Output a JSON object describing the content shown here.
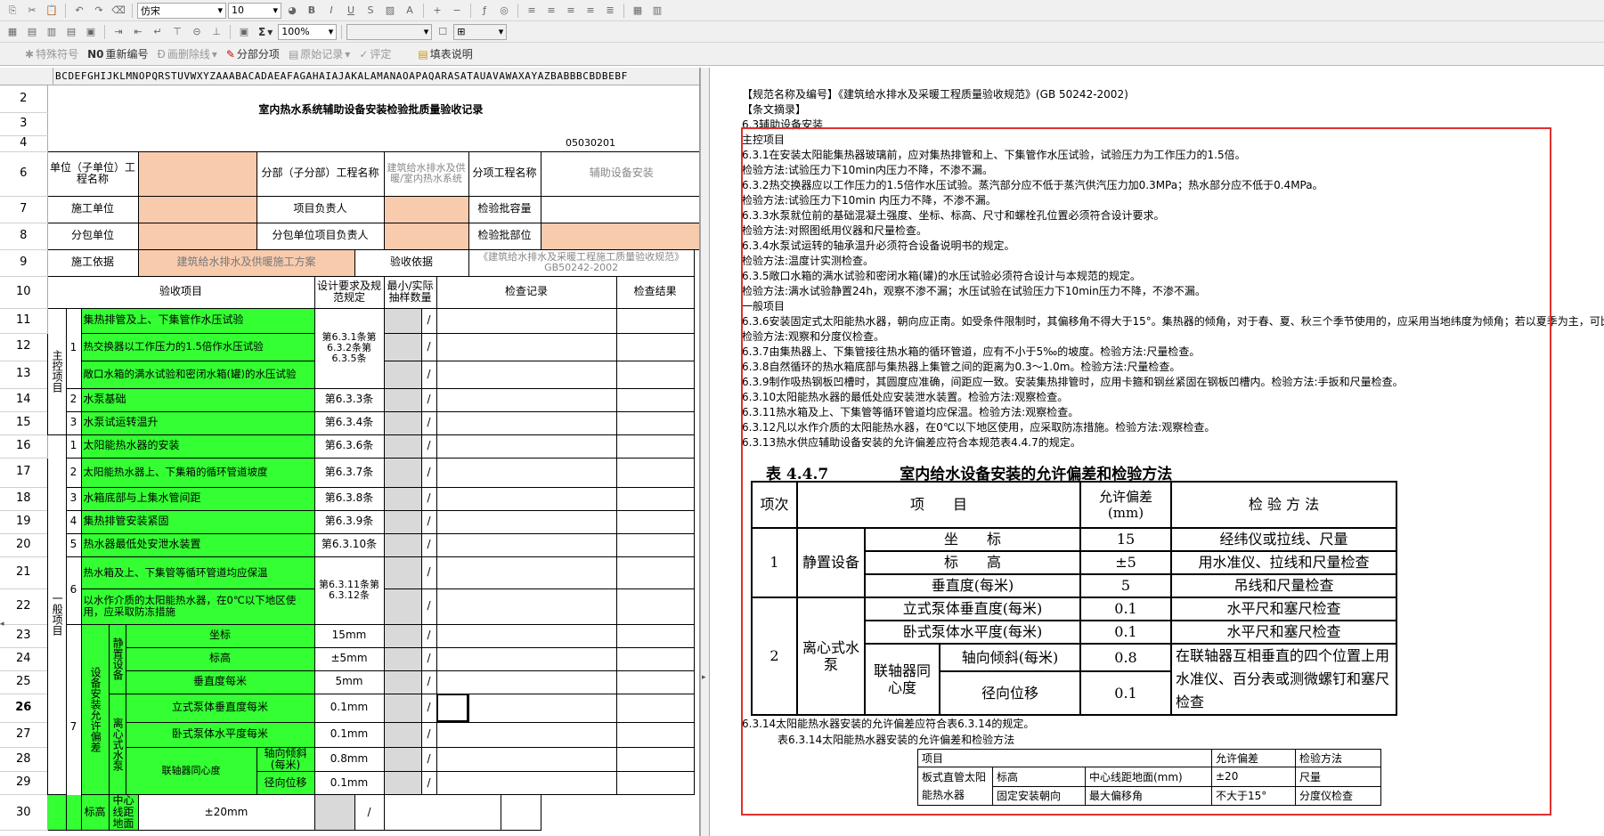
{
  "toolbar": {
    "font_family": "仿宋",
    "font_size": "10",
    "zoom": "100%",
    "special_symbol": "特殊符号",
    "renumber": "重新编号",
    "delete_line": "画删除线",
    "sub_item": "分部分项",
    "origin_record": "原始记录",
    "evaluate": "评定",
    "form_desc": "填表说明",
    "sigma": "Σ"
  },
  "sheet": {
    "col_letters": "BCDEFGHIJKLMNOPQRSTUVWXYZAAABACADAEAFAGAHAIAJAKALAMANAOAPAQARASATAUAVAWAXAYAZBABBBCBDBEBF",
    "rows": [
      "2",
      "3",
      "4",
      "6",
      "7",
      "8",
      "9",
      "10",
      "11",
      "12",
      "13",
      "14",
      "15",
      "16",
      "17",
      "18",
      "19",
      "20",
      "21",
      "22",
      "23",
      "24",
      "25",
      "26",
      "27",
      "28",
      "29",
      "30"
    ],
    "title": "室内热水系统辅助设备安装检验批质量验收记录",
    "code": "05030201",
    "unit_label": "单位（子单位）工程名称",
    "division_label": "分部（子分部）工程名称",
    "division_value": "建筑给水排水及供暖/室内热水系统",
    "subitem_label": "分项工程名称",
    "subitem_value": "辅助设备安装",
    "builder_label": "施工单位",
    "pm_label": "项目负责人",
    "capacity_label": "检验批容量",
    "subcontract_label": "分包单位",
    "subpm_label": "分包单位项目负责人",
    "location_label": "检验批部位",
    "basis_label": "施工依据",
    "basis_value": "建筑给水排水及供暖施工方案",
    "accept_basis_label": "验收依据",
    "accept_basis_value": "《建筑给水排水及采暖工程施工质量验收规范》GB50242-2002",
    "h_item": "验收项目",
    "h_design": "设计要求及规范规定",
    "h_sample": "最小/实际抽样数量",
    "h_record": "检查记录",
    "h_result": "检查结果",
    "main_group": "主控项目",
    "general_group": "一般项目",
    "slash": "/",
    "m1": "1",
    "m1a": "集热排管及上、下集管作水压试验",
    "m1b": "热交换器以工作压力的1.5倍作水压试验",
    "m1c": "敞口水箱的满水试验和密闭水箱(罐)的水压试验",
    "m1_spec": "第6.3.1条第6.3.2条第6.3.5条",
    "m2": "2",
    "m2a": "水泵基础",
    "m2_spec": "第6.3.3条",
    "m3": "3",
    "m3a": "水泵试运转温升",
    "m3_spec": "第6.3.4条",
    "g1": "1",
    "g1a": "太阳能热水器的安装",
    "g1_spec": "第6.3.6条",
    "g2": "2",
    "g2a": "太阳能热水器上、下集箱的循环管道坡度",
    "g2_spec": "第6.3.7条",
    "g3": "3",
    "g3a": "水箱底部与上集水管间距",
    "g3_spec": "第6.3.8条",
    "g4": "4",
    "g4a": "集热排管安装紧固",
    "g4_spec": "第6.3.9条",
    "g5": "5",
    "g5a": "热水器最低处安泄水装置",
    "g5_spec": "第6.3.10条",
    "g6": "6",
    "g6a": "热水箱及上、下集管等循环管道均应保温",
    "g6b": "以水作介质的太阳能热水器，在0℃以下地区使用，应采取防冻措施",
    "g6_spec": "第6.3.11条第6.3.12条",
    "g7": "7",
    "g7_group": "设备安装允许偏差",
    "static_equip": "静置设备",
    "coord": "坐标",
    "coord_spec": "15mm",
    "elev": "标高",
    "elev_spec": "±5mm",
    "vert": "垂直度每米",
    "vert_spec": "5mm",
    "centrifugal": "离心式水泵",
    "pump_vert": "立式泵体垂直度每米",
    "pump_vert_spec": "0.1mm",
    "pump_horiz": "卧式泵体水平度每米",
    "pump_horiz_spec": "0.1mm",
    "coupling": "联轴器同心度",
    "axial": "轴向倾斜(每米)",
    "axial_spec": "0.8mm",
    "radial": "径向位移",
    "radial_spec": "0.1mm",
    "r30a": "标高",
    "r30b": "中心线距地面",
    "r30_spec": "±20mm"
  },
  "doc": {
    "lines": [
      "【规范名称及编号】《建筑给水排水及采暖工程质量验收规范》(GB 50242-2002)",
      "【条文摘录】",
      "6.3辅助设备安装",
      "主控项目",
      "6.3.1在安装太阳能集热器玻璃前，应对集热排管和上、下集管作水压试验，试验压力为工作压力的1.5倍。",
      "检验方法:试验压力下10min内压力不降，不渗不漏。",
      "6.3.2热交换器应以工作压力的1.5倍作水压试验。蒸汽部分应不低于蒸汽供汽压力加0.3MPa；热水部分应不低于0.4MPa。",
      "检验方法:试验压力下10min 内压力不降，不渗不漏。",
      "6.3.3水泵就位前的基础混凝土强度、坐标、标高、尺寸和螺栓孔位置必须符合设计要求。",
      "检验方法:对照图纸用仪器和尺量检查。",
      "6.3.4水泵试运转的轴承温升必须符合设备说明书的规定。",
      "检验方法:温度计实测检查。",
      "6.3.5敞口水箱的满水试验和密闭水箱(罐)的水压试验必须符合设计与本规范的规定。",
      "检验方法:满水试验静置24h，观察不渗不漏；水压试验在试验压力下10min压力不降，不渗不漏。",
      "一般项目",
      "6.3.6安装固定式太阳能热水器，朝向应正南。如受条件限制时，其偏移角不得大于15°。集热器的倾角，对于春、夏、秋三个季节使用的，应采用当地纬度为倾角；若以夏季为主，可比当地纬度减少10°。",
      "检验方法:观察和分度仪检查。",
      "6.3.7由集热器上、下集管接往热水箱的循环管道，应有不小于5‰的坡度。检验方法:尺量检查。",
      "6.3.8自然循环的热水箱底部与集热器上集管之间的距离为0.3～1.0m。检验方法:尺量检查。",
      "6.3.9制作吸热钢板凹槽时，其圆度应准确，间距应一致。安装集热排管时，应用卡箍和钢丝紧固在钢板凹槽内。检验方法:手扳和尺量检查。",
      "6.3.10太阳能热水器的最低处应安装泄水装置。检验方法:观察检查。",
      "6.3.11热水箱及上、下集管等循环管道均应保温。检验方法:观察检查。",
      "6.3.12凡以水作介质的太阳能热水器，在0℃以下地区使用，应采取防冻措施。检验方法:观察检查。",
      "6.3.13热水供应辅助设备安装的允许偏差应符合本规范表4.4.7的规定。"
    ],
    "line_after": "6.3.14太阳能热水器安装的允许偏差应符合表6.3.14的规定。",
    "t447_caption_no": "表 4.4.7",
    "t447_caption": "室内给水设备安装的允许偏差和检验方法",
    "t447": {
      "h_no": "项次",
      "h_item": "项　　目",
      "h_dev": "允许偏差(mm)",
      "h_method": "检 验 方 法",
      "n1": "1",
      "static": "静置设备",
      "coord": "坐　　标",
      "coord_v": "15",
      "coord_m": "经纬仪或拉线、尺量",
      "elev": "标　　高",
      "elev_v": "±5",
      "elev_m": "用水准仪、拉线和尺量检查",
      "vert": "垂直度(每米)",
      "vert_v": "5",
      "vert_m": "吊线和尺量检查",
      "n2": "2",
      "pump": "离心式水　泵",
      "pv": "立式泵体垂直度(每米)",
      "pv_v": "0.1",
      "pv_m": "水平尺和塞尺检查",
      "ph": "卧式泵体水平度(每米)",
      "ph_v": "0.1",
      "ph_m": "水平尺和塞尺检查",
      "coupling": "联轴器同心度",
      "axial": "轴向倾斜(每米)",
      "axial_v": "0.8",
      "radial": "径向位移",
      "radial_v": "0.1",
      "coupling_m": "在联轴器互相垂直的四个位置上用水准仪、百分表或测微螺钉和塞尺检查"
    },
    "t6314_caption": "表6.3.14太阳能热水器安装的允许偏差和检验方法",
    "t6314": {
      "h_item": "项目",
      "h_dev": "允许偏差",
      "h_method": "检验方法",
      "type": "板式直管太阳能热水器",
      "r1a": "标高",
      "r1b": "中心线距地面(mm)",
      "r1v": "±20",
      "r1m": "尺量",
      "r2a": "固定安装朝向",
      "r2b": "最大偏移角",
      "r2v": "不大于15°",
      "r2m": "分度仪检查"
    }
  }
}
